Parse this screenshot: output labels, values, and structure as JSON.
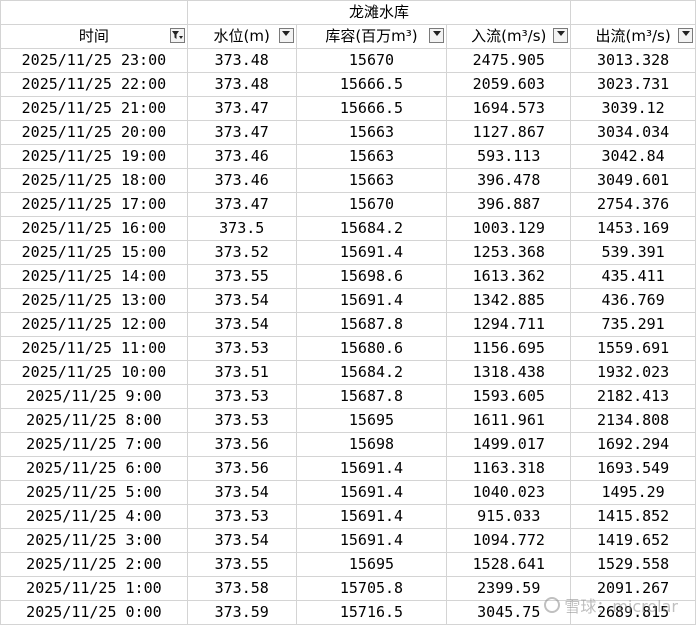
{
  "title": "龙滩水库",
  "columns": [
    {
      "label": "时间",
      "filter": "active"
    },
    {
      "label": "水位(m)",
      "filter": "dropdown"
    },
    {
      "label": "库容(百万m³)",
      "filter": "dropdown"
    },
    {
      "label": "入流(m³/s)",
      "filter": "dropdown"
    },
    {
      "label": "出流(m³/s)",
      "filter": "dropdown"
    }
  ],
  "rows": [
    [
      "2025/11/25 23:00",
      "373.48",
      "15670",
      "2475.905",
      "3013.328"
    ],
    [
      "2025/11/25 22:00",
      "373.48",
      "15666.5",
      "2059.603",
      "3023.731"
    ],
    [
      "2025/11/25 21:00",
      "373.47",
      "15666.5",
      "1694.573",
      "3039.12"
    ],
    [
      "2025/11/25 20:00",
      "373.47",
      "15663",
      "1127.867",
      "3034.034"
    ],
    [
      "2025/11/25 19:00",
      "373.46",
      "15663",
      "593.113",
      "3042.84"
    ],
    [
      "2025/11/25 18:00",
      "373.46",
      "15663",
      "396.478",
      "3049.601"
    ],
    [
      "2025/11/25 17:00",
      "373.47",
      "15670",
      "396.887",
      "2754.376"
    ],
    [
      "2025/11/25 16:00",
      "373.5",
      "15684.2",
      "1003.129",
      "1453.169"
    ],
    [
      "2025/11/25 15:00",
      "373.52",
      "15691.4",
      "1253.368",
      "539.391"
    ],
    [
      "2025/11/25 14:00",
      "373.55",
      "15698.6",
      "1613.362",
      "435.411"
    ],
    [
      "2025/11/25 13:00",
      "373.54",
      "15691.4",
      "1342.885",
      "436.769"
    ],
    [
      "2025/11/25 12:00",
      "373.54",
      "15687.8",
      "1294.711",
      "735.291"
    ],
    [
      "2025/11/25 11:00",
      "373.53",
      "15680.6",
      "1156.695",
      "1559.691"
    ],
    [
      "2025/11/25 10:00",
      "373.51",
      "15684.2",
      "1318.438",
      "1932.023"
    ],
    [
      "2025/11/25 9:00",
      "373.53",
      "15687.8",
      "1593.605",
      "2182.413"
    ],
    [
      "2025/11/25 8:00",
      "373.53",
      "15695",
      "1611.961",
      "2134.808"
    ],
    [
      "2025/11/25 7:00",
      "373.56",
      "15698",
      "1499.017",
      "1692.294"
    ],
    [
      "2025/11/25 6:00",
      "373.56",
      "15691.4",
      "1163.318",
      "1693.549"
    ],
    [
      "2025/11/25 5:00",
      "373.54",
      "15691.4",
      "1040.023",
      "1495.29"
    ],
    [
      "2025/11/25 4:00",
      "373.53",
      "15691.4",
      "915.033",
      "1415.852"
    ],
    [
      "2025/11/25 3:00",
      "373.54",
      "15691.4",
      "1094.772",
      "1419.652"
    ],
    [
      "2025/11/25 2:00",
      "373.55",
      "15695",
      "1528.641",
      "1529.558"
    ],
    [
      "2025/11/25 1:00",
      "373.58",
      "15705.8",
      "2399.59",
      "2091.267"
    ],
    [
      "2025/11/25 0:00",
      "373.59",
      "15716.5",
      "3045.75",
      "2689.815"
    ]
  ],
  "watermark": "雪球：microlar"
}
